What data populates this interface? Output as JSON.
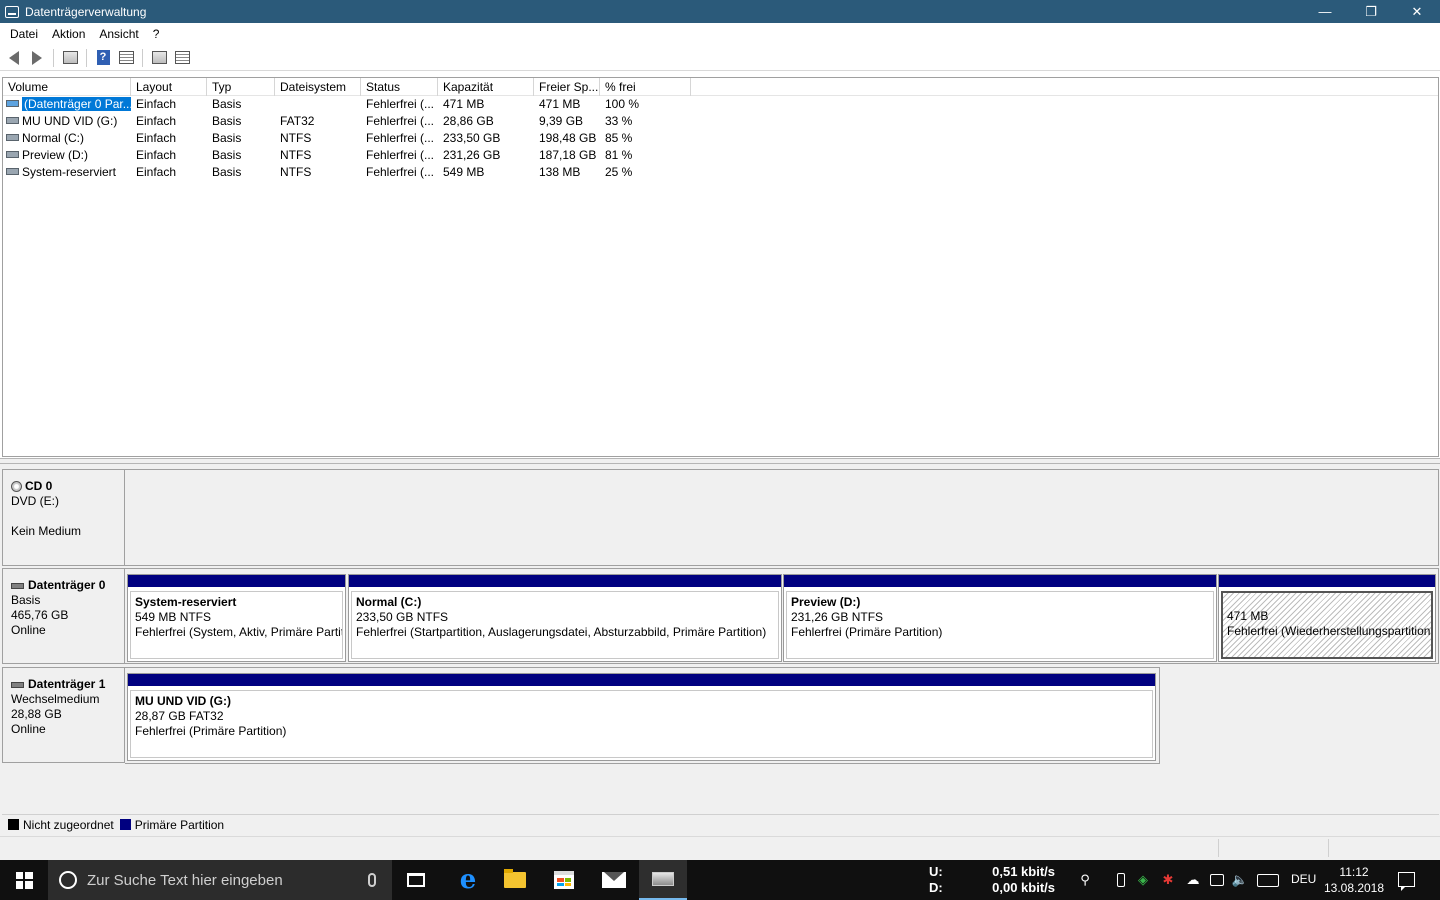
{
  "window": {
    "title": "Datenträgerverwaltung"
  },
  "menu": [
    "Datei",
    "Aktion",
    "Ansicht",
    "?"
  ],
  "volume_list": {
    "columns": [
      "Volume",
      "Layout",
      "Typ",
      "Dateisystem",
      "Status",
      "Kapazität",
      "Freier Sp...",
      "% frei"
    ],
    "rows": [
      [
        "(Datenträger 0 Par...",
        "Einfach",
        "Basis",
        "",
        "Fehlerfrei (...",
        "471 MB",
        "471 MB",
        "100 %"
      ],
      [
        "MU UND VID (G:)",
        "Einfach",
        "Basis",
        "FAT32",
        "Fehlerfrei (...",
        "28,86 GB",
        "9,39 GB",
        "33 %"
      ],
      [
        "Normal (C:)",
        "Einfach",
        "Basis",
        "NTFS",
        "Fehlerfrei (...",
        "233,50 GB",
        "198,48 GB",
        "85 %"
      ],
      [
        "Preview (D:)",
        "Einfach",
        "Basis",
        "NTFS",
        "Fehlerfrei (...",
        "231,26 GB",
        "187,18 GB",
        "81 %"
      ],
      [
        "System-reserviert",
        "Einfach",
        "Basis",
        "NTFS",
        "Fehlerfrei (...",
        "549 MB",
        "138 MB",
        "25 %"
      ]
    ]
  },
  "disks": {
    "cd0": {
      "name": "CD 0",
      "line1": "DVD (E:)",
      "line2": "Kein Medium"
    },
    "disk0": {
      "name": "Datenträger 0",
      "type": "Basis",
      "size": "465,76 GB",
      "state": "Online",
      "partitions": [
        {
          "name": "System-reserviert",
          "size": "549 MB NTFS",
          "status": "Fehlerfrei (System, Aktiv, Primäre Partit"
        },
        {
          "name": "Normal  (C:)",
          "size": "233,50 GB NTFS",
          "status": "Fehlerfrei (Startpartition, Auslagerungsdatei, Absturzabbild, Primäre Partition)"
        },
        {
          "name": "Preview  (D:)",
          "size": "231,26 GB NTFS",
          "status": "Fehlerfrei (Primäre Partition)"
        },
        {
          "name": "",
          "size": "471 MB",
          "status": "Fehlerfrei (Wiederherstellungspartition"
        }
      ]
    },
    "disk1": {
      "name": "Datenträger 1",
      "type": "Wechselmedium",
      "size": "28,88 GB",
      "state": "Online",
      "partitions": [
        {
          "name": "MU UND VID  (G:)",
          "size": "28,87 GB FAT32",
          "status": "Fehlerfrei (Primäre Partition)"
        }
      ]
    }
  },
  "legend": [
    {
      "label": "Nicht zugeordnet",
      "color": "#000000"
    },
    {
      "label": "Primäre Partition",
      "color": "#000080"
    }
  ],
  "taskbar": {
    "search_placeholder": "Zur Suche Text hier eingeben",
    "net_up_label": "U:",
    "net_up_value": "0,51 kbit/s",
    "net_down_label": "D:",
    "net_down_value": "0,00 kbit/s",
    "language": "DEU",
    "time": "11:12",
    "date": "13.08.2018"
  }
}
